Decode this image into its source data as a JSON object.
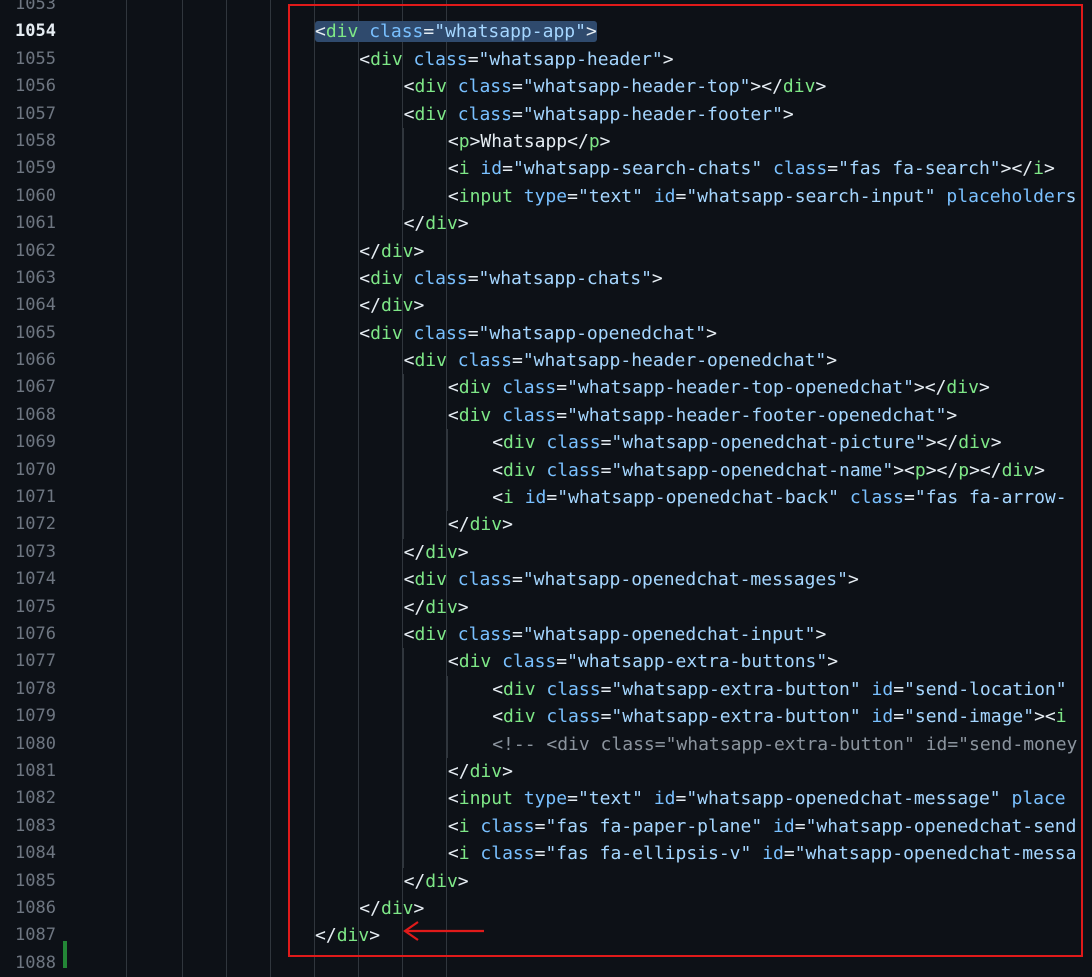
{
  "editor": {
    "current_line": 1054,
    "lines": [
      {
        "num": 1053,
        "indent": 0,
        "tokens": []
      },
      {
        "num": 1054,
        "indent": 0,
        "highlight": true,
        "tokens": [
          [
            "p",
            "<"
          ],
          [
            "t",
            "div"
          ],
          [
            "a",
            " class"
          ],
          [
            "p",
            "="
          ],
          [
            "s",
            "\"whatsapp-app\""
          ],
          [
            "p",
            ">"
          ]
        ]
      },
      {
        "num": 1055,
        "indent": 1,
        "tokens": [
          [
            "p",
            "<"
          ],
          [
            "t",
            "div"
          ],
          [
            "a",
            " class"
          ],
          [
            "p",
            "="
          ],
          [
            "s",
            "\"whatsapp-header\""
          ],
          [
            "p",
            ">"
          ]
        ]
      },
      {
        "num": 1056,
        "indent": 2,
        "tokens": [
          [
            "p",
            "<"
          ],
          [
            "t",
            "div"
          ],
          [
            "a",
            " class"
          ],
          [
            "p",
            "="
          ],
          [
            "s",
            "\"whatsapp-header-top\""
          ],
          [
            "p",
            "></"
          ],
          [
            "t",
            "div"
          ],
          [
            "p",
            ">"
          ]
        ]
      },
      {
        "num": 1057,
        "indent": 2,
        "tokens": [
          [
            "p",
            "<"
          ],
          [
            "t",
            "div"
          ],
          [
            "a",
            " class"
          ],
          [
            "p",
            "="
          ],
          [
            "s",
            "\"whatsapp-header-footer\""
          ],
          [
            "p",
            ">"
          ]
        ]
      },
      {
        "num": 1058,
        "indent": 3,
        "tokens": [
          [
            "p",
            "<"
          ],
          [
            "t",
            "p"
          ],
          [
            "p",
            ">"
          ],
          [
            "x",
            "Whatsapp"
          ],
          [
            "p",
            "</"
          ],
          [
            "t",
            "p"
          ],
          [
            "p",
            ">"
          ]
        ]
      },
      {
        "num": 1059,
        "indent": 3,
        "tokens": [
          [
            "p",
            "<"
          ],
          [
            "t",
            "i"
          ],
          [
            "a",
            " id"
          ],
          [
            "p",
            "="
          ],
          [
            "s",
            "\"whatsapp-search-chats\""
          ],
          [
            "a",
            " class"
          ],
          [
            "p",
            "="
          ],
          [
            "s",
            "\"fas fa-search\""
          ],
          [
            "p",
            "></"
          ],
          [
            "t",
            "i"
          ],
          [
            "p",
            ">"
          ]
        ]
      },
      {
        "num": 1060,
        "indent": 3,
        "tokens": [
          [
            "p",
            "<"
          ],
          [
            "t",
            "input"
          ],
          [
            "a",
            " type"
          ],
          [
            "p",
            "="
          ],
          [
            "s",
            "\"text\""
          ],
          [
            "a",
            " id"
          ],
          [
            "p",
            "="
          ],
          [
            "s",
            "\"whatsapp-search-input\""
          ],
          [
            "a",
            " placeholder"
          ],
          [
            "s",
            "s"
          ]
        ]
      },
      {
        "num": 1061,
        "indent": 2,
        "tokens": [
          [
            "p",
            "</"
          ],
          [
            "t",
            "div"
          ],
          [
            "p",
            ">"
          ]
        ]
      },
      {
        "num": 1062,
        "indent": 1,
        "tokens": [
          [
            "p",
            "</"
          ],
          [
            "t",
            "div"
          ],
          [
            "p",
            ">"
          ]
        ]
      },
      {
        "num": 1063,
        "indent": 1,
        "tokens": [
          [
            "p",
            "<"
          ],
          [
            "t",
            "div"
          ],
          [
            "a",
            " class"
          ],
          [
            "p",
            "="
          ],
          [
            "s",
            "\"whatsapp-chats\""
          ],
          [
            "p",
            ">"
          ]
        ]
      },
      {
        "num": 1064,
        "indent": 1,
        "tokens": [
          [
            "p",
            "</"
          ],
          [
            "t",
            "div"
          ],
          [
            "p",
            ">"
          ]
        ]
      },
      {
        "num": 1065,
        "indent": 1,
        "tokens": [
          [
            "p",
            "<"
          ],
          [
            "t",
            "div"
          ],
          [
            "a",
            " class"
          ],
          [
            "p",
            "="
          ],
          [
            "s",
            "\"whatsapp-openedchat\""
          ],
          [
            "p",
            ">"
          ]
        ]
      },
      {
        "num": 1066,
        "indent": 2,
        "tokens": [
          [
            "p",
            "<"
          ],
          [
            "t",
            "div"
          ],
          [
            "a",
            " class"
          ],
          [
            "p",
            "="
          ],
          [
            "s",
            "\"whatsapp-header-openedchat\""
          ],
          [
            "p",
            ">"
          ]
        ]
      },
      {
        "num": 1067,
        "indent": 3,
        "tokens": [
          [
            "p",
            "<"
          ],
          [
            "t",
            "div"
          ],
          [
            "a",
            " class"
          ],
          [
            "p",
            "="
          ],
          [
            "s",
            "\"whatsapp-header-top-openedchat\""
          ],
          [
            "p",
            "></"
          ],
          [
            "t",
            "div"
          ],
          [
            "p",
            ">"
          ]
        ]
      },
      {
        "num": 1068,
        "indent": 3,
        "tokens": [
          [
            "p",
            "<"
          ],
          [
            "t",
            "div"
          ],
          [
            "a",
            " class"
          ],
          [
            "p",
            "="
          ],
          [
            "s",
            "\"whatsapp-header-footer-openedchat\""
          ],
          [
            "p",
            ">"
          ]
        ]
      },
      {
        "num": 1069,
        "indent": 4,
        "tokens": [
          [
            "p",
            "<"
          ],
          [
            "t",
            "div"
          ],
          [
            "a",
            " class"
          ],
          [
            "p",
            "="
          ],
          [
            "s",
            "\"whatsapp-openedchat-picture\""
          ],
          [
            "p",
            "></"
          ],
          [
            "t",
            "div"
          ],
          [
            "p",
            ">"
          ]
        ]
      },
      {
        "num": 1070,
        "indent": 4,
        "tokens": [
          [
            "p",
            "<"
          ],
          [
            "t",
            "div"
          ],
          [
            "a",
            " class"
          ],
          [
            "p",
            "="
          ],
          [
            "s",
            "\"whatsapp-openedchat-name\""
          ],
          [
            "p",
            "><"
          ],
          [
            "t",
            "p"
          ],
          [
            "p",
            "></"
          ],
          [
            "t",
            "p"
          ],
          [
            "p",
            "></"
          ],
          [
            "t",
            "div"
          ],
          [
            "p",
            ">"
          ]
        ]
      },
      {
        "num": 1071,
        "indent": 4,
        "tokens": [
          [
            "p",
            "<"
          ],
          [
            "t",
            "i"
          ],
          [
            "a",
            " id"
          ],
          [
            "p",
            "="
          ],
          [
            "s",
            "\"whatsapp-openedchat-back\""
          ],
          [
            "a",
            " class"
          ],
          [
            "p",
            "="
          ],
          [
            "s",
            "\"fas fa-arrow-"
          ]
        ]
      },
      {
        "num": 1072,
        "indent": 3,
        "tokens": [
          [
            "p",
            "</"
          ],
          [
            "t",
            "div"
          ],
          [
            "p",
            ">"
          ]
        ]
      },
      {
        "num": 1073,
        "indent": 2,
        "tokens": [
          [
            "p",
            "</"
          ],
          [
            "t",
            "div"
          ],
          [
            "p",
            ">"
          ]
        ]
      },
      {
        "num": 1074,
        "indent": 2,
        "tokens": [
          [
            "p",
            "<"
          ],
          [
            "t",
            "div"
          ],
          [
            "a",
            " class"
          ],
          [
            "p",
            "="
          ],
          [
            "s",
            "\"whatsapp-openedchat-messages\""
          ],
          [
            "p",
            ">"
          ]
        ]
      },
      {
        "num": 1075,
        "indent": 2,
        "tokens": [
          [
            "p",
            "</"
          ],
          [
            "t",
            "div"
          ],
          [
            "p",
            ">"
          ]
        ]
      },
      {
        "num": 1076,
        "indent": 2,
        "tokens": [
          [
            "p",
            "<"
          ],
          [
            "t",
            "div"
          ],
          [
            "a",
            " class"
          ],
          [
            "p",
            "="
          ],
          [
            "s",
            "\"whatsapp-openedchat-input\""
          ],
          [
            "p",
            ">"
          ]
        ]
      },
      {
        "num": 1077,
        "indent": 3,
        "tokens": [
          [
            "p",
            "<"
          ],
          [
            "t",
            "div"
          ],
          [
            "a",
            " class"
          ],
          [
            "p",
            "="
          ],
          [
            "s",
            "\"whatsapp-extra-buttons\""
          ],
          [
            "p",
            ">"
          ]
        ]
      },
      {
        "num": 1078,
        "indent": 4,
        "tokens": [
          [
            "p",
            "<"
          ],
          [
            "t",
            "div"
          ],
          [
            "a",
            " class"
          ],
          [
            "p",
            "="
          ],
          [
            "s",
            "\"whatsapp-extra-button\""
          ],
          [
            "a",
            " id"
          ],
          [
            "p",
            "="
          ],
          [
            "s",
            "\"send-location\""
          ]
        ]
      },
      {
        "num": 1079,
        "indent": 4,
        "tokens": [
          [
            "p",
            "<"
          ],
          [
            "t",
            "div"
          ],
          [
            "a",
            " class"
          ],
          [
            "p",
            "="
          ],
          [
            "s",
            "\"whatsapp-extra-button\""
          ],
          [
            "a",
            " id"
          ],
          [
            "p",
            "="
          ],
          [
            "s",
            "\"send-image\""
          ],
          [
            "p",
            "><"
          ],
          [
            "t",
            "i"
          ]
        ]
      },
      {
        "num": 1080,
        "indent": 4,
        "tokens": [
          [
            "c",
            "<!-- <div class=\"whatsapp-extra-button\" id=\"send-money"
          ]
        ]
      },
      {
        "num": 1081,
        "indent": 3,
        "tokens": [
          [
            "p",
            "</"
          ],
          [
            "t",
            "div"
          ],
          [
            "p",
            ">"
          ]
        ]
      },
      {
        "num": 1082,
        "indent": 3,
        "tokens": [
          [
            "p",
            "<"
          ],
          [
            "t",
            "input"
          ],
          [
            "a",
            " type"
          ],
          [
            "p",
            "="
          ],
          [
            "s",
            "\"text\""
          ],
          [
            "a",
            " id"
          ],
          [
            "p",
            "="
          ],
          [
            "s",
            "\"whatsapp-openedchat-message\""
          ],
          [
            "a",
            " place"
          ]
        ]
      },
      {
        "num": 1083,
        "indent": 3,
        "tokens": [
          [
            "p",
            "<"
          ],
          [
            "t",
            "i"
          ],
          [
            "a",
            " class"
          ],
          [
            "p",
            "="
          ],
          [
            "s",
            "\"fas fa-paper-plane\""
          ],
          [
            "a",
            " id"
          ],
          [
            "p",
            "="
          ],
          [
            "s",
            "\"whatsapp-openedchat-send"
          ]
        ]
      },
      {
        "num": 1084,
        "indent": 3,
        "tokens": [
          [
            "p",
            "<"
          ],
          [
            "t",
            "i"
          ],
          [
            "a",
            " class"
          ],
          [
            "p",
            "="
          ],
          [
            "s",
            "\"fas fa-ellipsis-v\""
          ],
          [
            "a",
            " id"
          ],
          [
            "p",
            "="
          ],
          [
            "s",
            "\"whatsapp-openedchat-messa"
          ]
        ]
      },
      {
        "num": 1085,
        "indent": 2,
        "tokens": [
          [
            "p",
            "</"
          ],
          [
            "t",
            "div"
          ],
          [
            "p",
            ">"
          ]
        ]
      },
      {
        "num": 1086,
        "indent": 1,
        "tokens": [
          [
            "p",
            "</"
          ],
          [
            "t",
            "div"
          ],
          [
            "p",
            ">"
          ]
        ]
      },
      {
        "num": 1087,
        "indent": 0,
        "tokens": [
          [
            "p",
            "</"
          ],
          [
            "t",
            "div"
          ],
          [
            "p",
            ">"
          ]
        ]
      },
      {
        "num": 1088,
        "indent": 0,
        "tokens": []
      }
    ]
  },
  "colors": {
    "background": "#0d1117",
    "punct": "#e6edf3",
    "tag": "#7ee787",
    "attr": "#79c0ff",
    "string": "#a5d6ff",
    "comment": "#8b949e",
    "annotation": "#e01a1a"
  },
  "annotation": {
    "box": "red-rectangle",
    "arrow": "arrow-left-icon"
  }
}
